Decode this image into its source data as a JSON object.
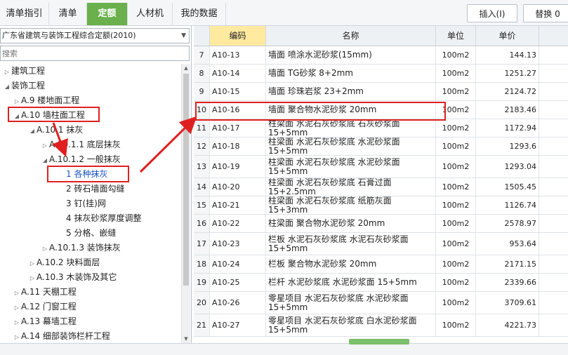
{
  "tabs": [
    {
      "label": "清单指引",
      "active": false
    },
    {
      "label": "清单",
      "active": false
    },
    {
      "label": "定额",
      "active": true
    },
    {
      "label": "人材机",
      "active": false
    },
    {
      "label": "我的数据",
      "active": false
    }
  ],
  "toolbar": {
    "insert_label": "插入(I)",
    "replace_label": "替换 0"
  },
  "library": {
    "selected": "广东省建筑与装饰工程综合定额(2010)"
  },
  "search": {
    "placeholder": "搜索"
  },
  "tree": [
    {
      "label": "建筑工程",
      "toggle": "▷"
    },
    {
      "label": "装饰工程",
      "toggle": "◢"
    },
    {
      "label": "A.9 楼地面工程",
      "toggle": "▷"
    },
    {
      "label": "A.10 墙柱面工程",
      "toggle": "◢"
    },
    {
      "label": "A.10.1 抹灰",
      "toggle": "◢"
    },
    {
      "label": "A.10.1.1 底层抹灰",
      "toggle": "▷"
    },
    {
      "label": "A.10.1.2 一般抹灰",
      "toggle": "◢"
    },
    {
      "label": "1 各种抹灰",
      "toggle": ""
    },
    {
      "label": "2 砖石墙面勾缝",
      "toggle": ""
    },
    {
      "label": "3 钉(挂)网",
      "toggle": ""
    },
    {
      "label": "4 抹灰砂浆厚度调整",
      "toggle": ""
    },
    {
      "label": "5 分格、嵌缝",
      "toggle": ""
    },
    {
      "label": "A.10.1.3 装饰抹灰",
      "toggle": "▷"
    },
    {
      "label": "A.10.2 块料面层",
      "toggle": "▷"
    },
    {
      "label": "A.10.3 木装饰及其它",
      "toggle": "▷"
    },
    {
      "label": "A.11 天棚工程",
      "toggle": "▷"
    },
    {
      "label": "A.12 门窗工程",
      "toggle": "▷"
    },
    {
      "label": "A.13 幕墙工程",
      "toggle": "▷"
    },
    {
      "label": "A.14 细部装饰栏杆工程",
      "toggle": "▷"
    }
  ],
  "table": {
    "headers": {
      "code": "编码",
      "name": "名称",
      "unit": "单位",
      "price": "单价"
    },
    "rows": [
      {
        "no": "7",
        "code": "A10-13",
        "name": [
          "墙面 喷涂水泥砂浆(15mm)"
        ],
        "unit": "100m2",
        "price": "144.13"
      },
      {
        "no": "8",
        "code": "A10-14",
        "name": [
          "墙面 TG砂浆 8+2mm"
        ],
        "unit": "100m2",
        "price": "1251.27"
      },
      {
        "no": "9",
        "code": "A10-15",
        "name": [
          "墙面 珍珠岩浆 23+2mm"
        ],
        "unit": "100m2",
        "price": "2124.72"
      },
      {
        "no": "10",
        "code": "A10-16",
        "name": [
          "墙面 聚合物水泥砂浆 20mm"
        ],
        "unit": "100m2",
        "price": "2183.46"
      },
      {
        "no": "11",
        "code": "A10-17",
        "name": [
          "柱梁面 水泥石灰砂浆底 石灰砂浆面 15+5mm"
        ],
        "unit": "100m2",
        "price": "1172.94"
      },
      {
        "no": "12",
        "code": "A10-18",
        "name": [
          "柱梁面 水泥石灰砂浆底 水泥砂浆面 15+5mm"
        ],
        "unit": "100m2",
        "price": "1293.6"
      },
      {
        "no": "13",
        "code": "A10-19",
        "name": [
          "柱梁面 水泥石灰砂浆底 水泥砂浆面",
          "15+5mm"
        ],
        "unit": "100m2",
        "price": "1293.04"
      },
      {
        "no": "14",
        "code": "A10-20",
        "name": [
          "柱梁面 水泥石灰砂浆底 石膏过面 15+2.5mm"
        ],
        "unit": "100m2",
        "price": "1505.45"
      },
      {
        "no": "15",
        "code": "A10-21",
        "name": [
          "柱梁面 水泥石灰砂浆底 纸筋灰面 15+3mm"
        ],
        "unit": "100m2",
        "price": "1126.74"
      },
      {
        "no": "16",
        "code": "A10-22",
        "name": [
          "柱梁面 聚合物水泥砂浆 20mm"
        ],
        "unit": "100m2",
        "price": "2578.97"
      },
      {
        "no": "17",
        "code": "A10-23",
        "name": [
          "栏板 水泥石灰砂浆底 水泥石灰砂浆面",
          "15+5mm"
        ],
        "unit": "100m2",
        "price": "953.64"
      },
      {
        "no": "18",
        "code": "A10-24",
        "name": [
          "栏板 聚合物水泥砂浆 20mm"
        ],
        "unit": "100m2",
        "price": "2171.15"
      },
      {
        "no": "19",
        "code": "A10-25",
        "name": [
          "栏杆 水泥砂浆底 水泥砂浆面 15+5mm"
        ],
        "unit": "100m2",
        "price": "2339.66"
      },
      {
        "no": "20",
        "code": "A10-26",
        "name": [
          "零星项目 水泥石灰砂浆底 水泥砂浆面",
          "15+5mm"
        ],
        "unit": "100m2",
        "price": "3709.61"
      },
      {
        "no": "21",
        "code": "A10-27",
        "name": [
          "零星项目 水泥石灰砂浆底 白水泥砂浆面",
          "15+5mm"
        ],
        "unit": "100m2",
        "price": "4221.73"
      }
    ]
  },
  "colors": {
    "accent": "#6ab04c",
    "annotation": "#e02020",
    "header_highlight": "#ffeaa0"
  }
}
